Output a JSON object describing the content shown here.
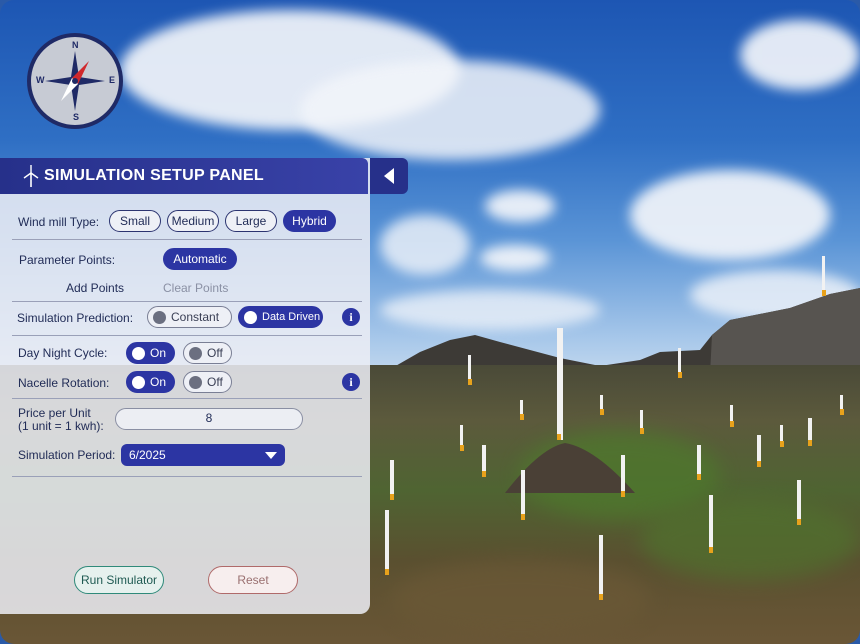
{
  "panel": {
    "title": "SIMULATION SETUP PANEL",
    "wind_mill_type": {
      "label": "Wind mill Type:",
      "options": [
        "Small",
        "Medium",
        "Large",
        "Hybrid"
      ],
      "selected": "Hybrid"
    },
    "parameter_points": {
      "label": "Parameter Points:",
      "mode": "Automatic",
      "add_points": "Add Points",
      "clear_points": "Clear Points"
    },
    "simulation_prediction": {
      "label": "Simulation Prediction:",
      "options": [
        "Constant",
        "Data Driven"
      ],
      "selected": "Data Driven",
      "info": "i"
    },
    "day_night_cycle": {
      "label": "Day Night Cycle:",
      "on": "On",
      "off": "Off",
      "value": "On"
    },
    "nacelle_rotation": {
      "label": "Nacelle Rotation:",
      "on": "On",
      "off": "Off",
      "value": "On",
      "info": "i"
    },
    "price_per_unit": {
      "label_line1": "Price per Unit",
      "label_line2": "(1 unit = 1 kwh):",
      "value": "8"
    },
    "simulation_period": {
      "label": "Simulation Period:",
      "value": "6/2025"
    },
    "run_label": "Run Simulator",
    "reset_label": "Reset"
  },
  "compass": {
    "north": "N",
    "east": "E",
    "south": "S",
    "west": "W"
  },
  "colors": {
    "accent": "#2c35a3",
    "header": "#26308a",
    "compass_needle": "#d0282c"
  }
}
